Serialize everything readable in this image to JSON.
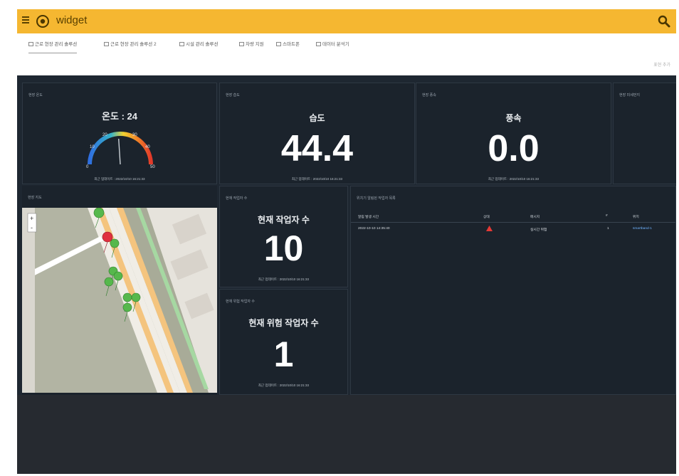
{
  "header": {
    "title": "widget",
    "menu_icon": "hamburger-icon",
    "logo_icon": "circle-logo-icon",
    "search_icon": "search-icon",
    "accent_color": "#f5b731"
  },
  "tabs": [
    {
      "label": "근로 현장 관리 솔루션",
      "active": true
    },
    {
      "label": "근로 현장 관리 솔루션 2"
    },
    {
      "label": "시설 관리 솔루션"
    },
    {
      "label": "차량 지원"
    },
    {
      "label": "스마트폰"
    },
    {
      "label": "데이터 분석기"
    }
  ],
  "subheader_link": "표현 추가",
  "cards": {
    "temperature": {
      "label": "현장 온도",
      "title": "온도 : 24",
      "gauge": {
        "value": 24,
        "min": 0,
        "max": 50,
        "ticks": [
          "0",
          "10",
          "20",
          "30",
          "40",
          "50"
        ]
      },
      "updated": "최근 업데이트 : 2022/10/10 16:21:33"
    },
    "humidity": {
      "label": "현장 습도",
      "title": "습도",
      "value": "44.4",
      "updated": "최근 업데이트 : 2022/10/10 16:21:33"
    },
    "wind": {
      "label": "현장 풍속",
      "title": "풍속",
      "value": "0.0",
      "updated": "최근 업데이트 : 2022/10/10 16:21:33"
    },
    "extra": {
      "label": "현장 미세먼지"
    },
    "map": {
      "label": "현장 지도",
      "zoom_in": "+",
      "zoom_out": "-"
    },
    "workers": {
      "label": "현재 작업자 수",
      "title": "현재 작업자 수",
      "value": "10",
      "updated": "최근 업데이트 : 2022/10/10 16:21:33"
    },
    "danger_workers": {
      "label": "현재 위험 작업자 수",
      "title": "현재 위험 작업자 수",
      "value": "1",
      "updated": "최근 업데이트 : 2022/10/10 16:21:33"
    },
    "alerts": {
      "label": "위치기 알림된 작업자 목록",
      "columns": [
        "알림 발생 시간",
        "상태",
        "메시지",
        "#",
        "위치"
      ],
      "rows": [
        [
          "2022-10-10 14:35:40",
          "warning-triangle-icon",
          "실시간 위험",
          "1",
          "smartband-1"
        ]
      ]
    }
  }
}
